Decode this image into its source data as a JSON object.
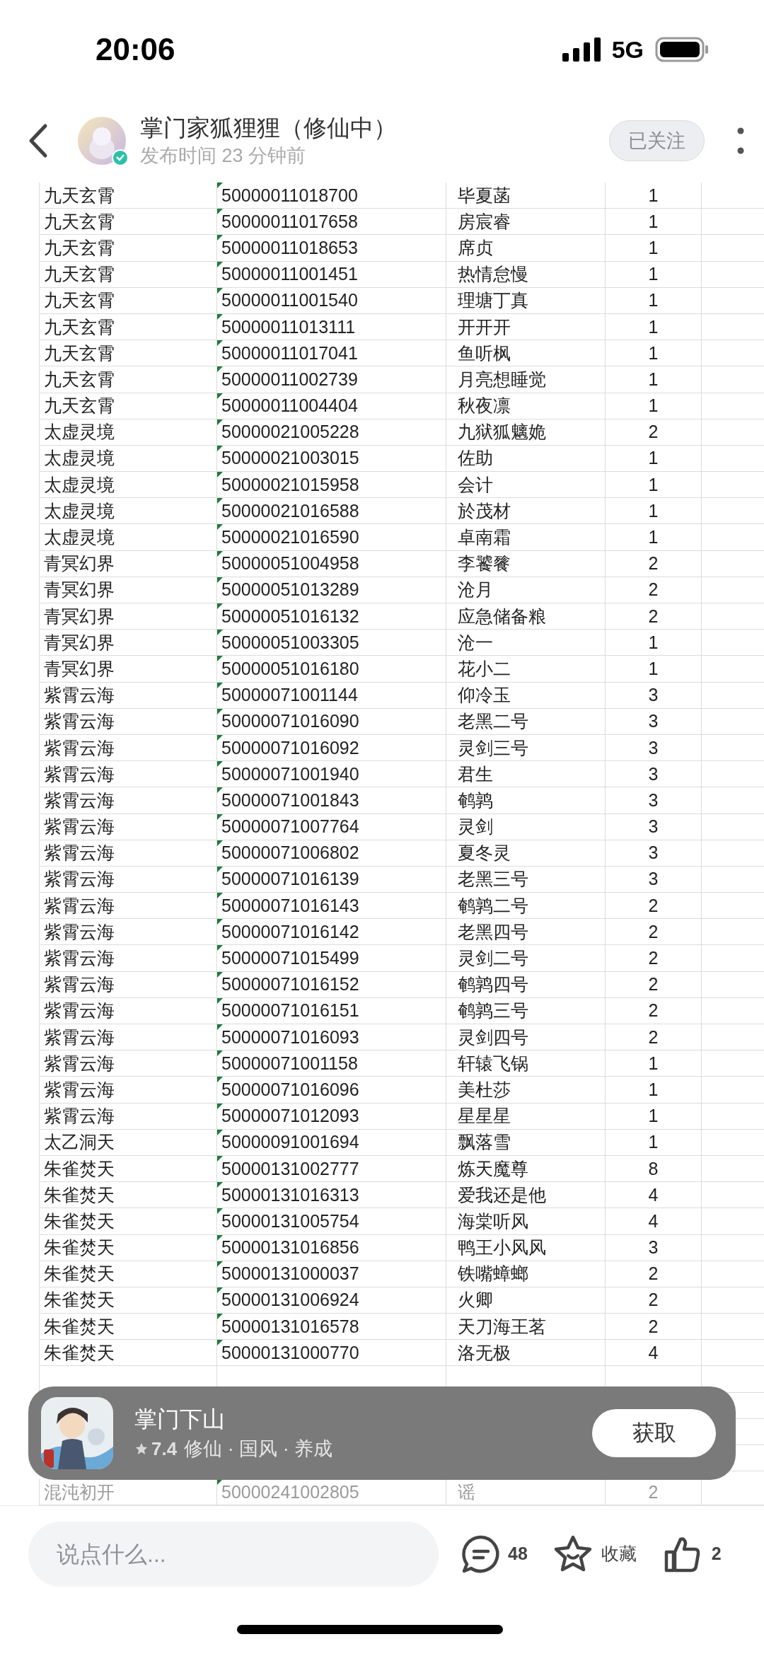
{
  "status_bar": {
    "time": "20:06",
    "network": "5G"
  },
  "header": {
    "author": "掌门家狐狸狸（修仙中）",
    "published": "发布时间 23 分钟前",
    "follow_button": {
      "label": "已关注",
      "selected": true
    }
  },
  "table": {
    "rows": [
      [
        "九天玄霄",
        "50000011018700",
        "毕夏菡",
        "1"
      ],
      [
        "九天玄霄",
        "50000011017658",
        "房宸睿",
        "1"
      ],
      [
        "九天玄霄",
        "50000011018653",
        "席贞",
        "1"
      ],
      [
        "九天玄霄",
        "50000011001451",
        "热情怠慢",
        "1"
      ],
      [
        "九天玄霄",
        "50000011001540",
        "理塘丁真",
        "1"
      ],
      [
        "九天玄霄",
        "50000011013111",
        "开开开",
        "1"
      ],
      [
        "九天玄霄",
        "50000011017041",
        "鱼听枫",
        "1"
      ],
      [
        "九天玄霄",
        "50000011002739",
        "月亮想睡觉",
        "1"
      ],
      [
        "九天玄霄",
        "50000011004404",
        "秋夜凛",
        "1"
      ],
      [
        "太虚灵境",
        "50000021005228",
        "九狱狐魑姽",
        "2"
      ],
      [
        "太虚灵境",
        "50000021003015",
        "佐助",
        "1"
      ],
      [
        "太虚灵境",
        "50000021015958",
        "会计",
        "1"
      ],
      [
        "太虚灵境",
        "50000021016588",
        "於茂材",
        "1"
      ],
      [
        "太虚灵境",
        "50000021016590",
        "卓南霜",
        "1"
      ],
      [
        "青冥幻界",
        "50000051004958",
        "李饕餮",
        "2"
      ],
      [
        "青冥幻界",
        "50000051013289",
        "沧月",
        "2"
      ],
      [
        "青冥幻界",
        "50000051016132",
        "应急储备粮",
        "2"
      ],
      [
        "青冥幻界",
        "50000051003305",
        "沧一",
        "1"
      ],
      [
        "青冥幻界",
        "50000051016180",
        "花小二",
        "1"
      ],
      [
        "紫霄云海",
        "50000071001144",
        "仰冷玉",
        "3"
      ],
      [
        "紫霄云海",
        "50000071016090",
        "老黑二号",
        "3"
      ],
      [
        "紫霄云海",
        "50000071016092",
        "灵剑三号",
        "3"
      ],
      [
        "紫霄云海",
        "50000071001940",
        "君生",
        "3"
      ],
      [
        "紫霄云海",
        "50000071001843",
        "鹌鹑",
        "3"
      ],
      [
        "紫霄云海",
        "50000071007764",
        "灵剑",
        "3"
      ],
      [
        "紫霄云海",
        "50000071006802",
        "夏冬灵",
        "3"
      ],
      [
        "紫霄云海",
        "50000071016139",
        "老黑三号",
        "3"
      ],
      [
        "紫霄云海",
        "50000071016143",
        "鹌鹑二号",
        "2"
      ],
      [
        "紫霄云海",
        "50000071016142",
        "老黑四号",
        "2"
      ],
      [
        "紫霄云海",
        "50000071015499",
        "灵剑二号",
        "2"
      ],
      [
        "紫霄云海",
        "50000071016152",
        "鹌鹑四号",
        "2"
      ],
      [
        "紫霄云海",
        "50000071016151",
        "鹌鹑三号",
        "2"
      ],
      [
        "紫霄云海",
        "50000071016093",
        "灵剑四号",
        "2"
      ],
      [
        "紫霄云海",
        "50000071001158",
        "轩辕飞锅",
        "1"
      ],
      [
        "紫霄云海",
        "50000071016096",
        "美杜莎",
        "1"
      ],
      [
        "紫霄云海",
        "50000071012093",
        "星星星",
        "1"
      ],
      [
        "太乙洞天",
        "50000091001694",
        "飘落雪",
        "1"
      ],
      [
        "朱雀焚天",
        "50000131002777",
        "炼天魔尊",
        "8"
      ],
      [
        "朱雀焚天",
        "50000131016313",
        "爱我还是他",
        "4"
      ],
      [
        "朱雀焚天",
        "50000131005754",
        "海棠听风",
        "4"
      ],
      [
        "朱雀焚天",
        "50000131016856",
        "鸭王小风风",
        "3"
      ],
      [
        "朱雀焚天",
        "50000131000037",
        "铁嘴蟑螂",
        "2"
      ],
      [
        "朱雀焚天",
        "50000131006924",
        "火卿",
        "2"
      ],
      [
        "朱雀焚天",
        "50000131016578",
        "天刀海王茗",
        "2"
      ],
      [
        "朱雀焚天",
        "50000131000770",
        "洛无极",
        "4"
      ]
    ],
    "faded_row": [
      "混沌初开",
      "50000241002805",
      "谣",
      "2"
    ]
  },
  "app_banner": {
    "name": "掌门下山",
    "rating": "7.4",
    "tags": "修仙 · 国风 · 养成",
    "button": "获取"
  },
  "bottom_bar": {
    "placeholder": "说点什么...",
    "comments": "48",
    "favorite": "收藏",
    "likes": "2"
  }
}
